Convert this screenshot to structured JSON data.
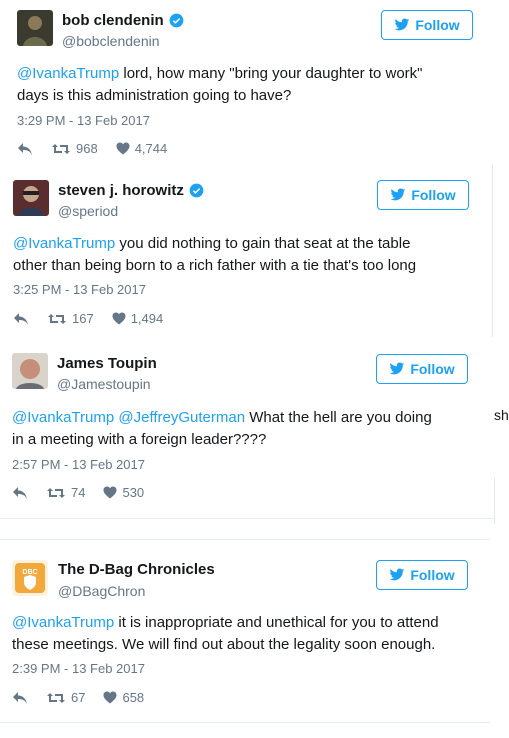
{
  "follow_label": "Follow",
  "stray_text": "sh",
  "icons": {
    "reply": "reply-icon",
    "retweet": "retweet-icon",
    "like": "heart-icon",
    "bird": "twitter-bird-icon",
    "verified": "verified-badge-icon"
  },
  "colors": {
    "accent": "#1da1f2",
    "muted": "#657786",
    "text": "#14171a",
    "divider": "#e6ecf0"
  },
  "tweets": [
    {
      "name": "bob clendenin",
      "handle": "@bobclendenin",
      "verified": true,
      "mentions": [
        "@IvankaTrump"
      ],
      "text_line1": " lord, how many \"bring your daughter to work\"",
      "text_line2": "days is this administration going to have?",
      "time": "3:29 PM - 13 Feb 2017",
      "retweets": "968",
      "likes": "4,744"
    },
    {
      "name": "steven j. horowitz",
      "handle": "@speriod",
      "verified": true,
      "mentions": [
        "@IvankaTrump"
      ],
      "text_line1": " you did nothing to gain that seat at the table",
      "text_line2": "other than being born to a rich father with a tie that's too long",
      "time": "3:25 PM - 13 Feb 2017",
      "retweets": "167",
      "likes": "1,494"
    },
    {
      "name": "James Toupin",
      "handle": "@Jamestoupin",
      "verified": false,
      "mentions": [
        "@IvankaTrump",
        "@JeffreyGuterman"
      ],
      "text_line1": " What the hell are you doing",
      "text_line2": "in a meeting with a foreign leader????",
      "time": "2:57 PM - 13 Feb 2017",
      "retweets": "74",
      "likes": "530"
    },
    {
      "name": "The D-Bag Chronicles",
      "handle": "@DBagChron",
      "verified": false,
      "mentions": [
        "@IvankaTrump"
      ],
      "text_line1": " it is inappropriate and unethical for you to attend",
      "text_line2": "these meetings. We will find out about the legality soon enough.",
      "time": "2:39 PM - 13 Feb 2017",
      "retweets": "67",
      "likes": "658",
      "avatar_text": "DBC"
    }
  ]
}
